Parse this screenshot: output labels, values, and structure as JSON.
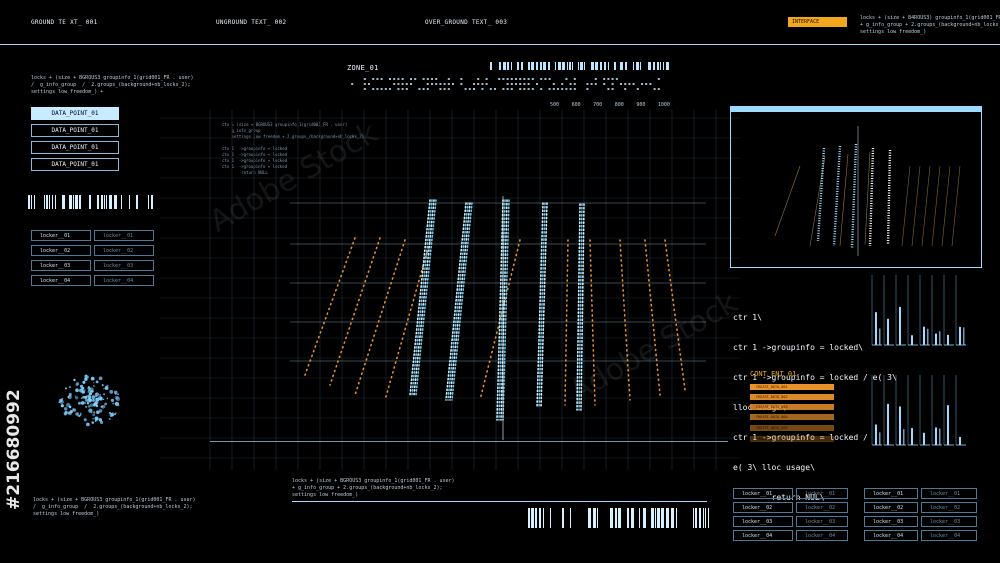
{
  "top_labels": [
    "GROUND TE    XT_ 001",
    "UNGROUND TEXT_ 002",
    "OVER_GROUND TEXT_ 003"
  ],
  "interface_badge": "INTERFACE",
  "top_right_code": "locks + (size + B4ROUS3) groupinfo_1(grid001_FR . user)\n+ g_info_group + 2.groups_(background+nb_locks_2)\nsettings low freedom_)",
  "left_code": "locks + (size + BGROUS3 groupinfo_1(grid001_FR . user)\n/  g_info_group  /  2.groups_(background+nb_locks_2);\nsettings low freedom_) +",
  "data_buttons": [
    "DATA_POINT_01",
    "DATA_POINT_01",
    "DATA_POINT_01",
    "DATA_POINT_01"
  ],
  "left_lockers": [
    [
      "locker__01",
      "locker__01"
    ],
    [
      "locker__02",
      "locker__02"
    ],
    [
      "locker__03",
      "locker__03"
    ],
    [
      "locker__04",
      "locker__04"
    ]
  ],
  "zone_label": "ZONE_01",
  "scale_ticks": [
    "500",
    "600",
    "700",
    "800",
    "900",
    "1000"
  ],
  "center_code": "ctx = (size + BGROUS3 groupinfo_1(grid001_FR . user)\n    g_info_group\n    settings low freedom + 2.groups_(background+nb_locks_2)\n\nctx 1  ->groupinfo + locked\nctx 1  ->groupinfo + locked\nctx 1  ->groupinfo + locked\nctx 1  ->groupinfo + locked\n        return NULL",
  "terminal_lines": [
    "ctr 1\\",
    "ctr 1 ->groupinfo = locked\\",
    "ctr 1 ->groupinfo = locked / e( 3\\",
    "lloc usage\\",
    "ctr 1 ->groupinfo = locked /",
    "e( 3\\ lloc usage\\",
    "        return NUL\\"
  ],
  "content_title": "CONT ENT_01",
  "content_bars": [
    "CREATE_DATA_001",
    "CREATE_DATA_002",
    "CREATE_DATA_003",
    "CREATE_DATA_004",
    "CREATE_DATA_005",
    "CREATE_DATA_006"
  ],
  "bottom_code": "locks + (size + BGROUS3 groupinfo_1(grid001_FR . user)\n+ g_info_group + 2.groups_(background+nb_locks_2);\nsettings low freedom_)",
  "bottom_left_code": "locks + (size + BGROUS3 groupinfo_1(grid001_FR . user)\n/  g_info_group  /  2.groups_(background+nb_locks_2);\nsettings low freedom_)",
  "bottom_lockers_left": [
    [
      "locker__01",
      "locker__01"
    ],
    [
      "locker__02",
      "locker__02"
    ],
    [
      "locker__03",
      "locker__03"
    ],
    [
      "locker__04",
      "locker__04"
    ]
  ],
  "bottom_lockers_right": [
    [
      "locker__01",
      "locker__01"
    ],
    [
      "locker__02",
      "locker__02"
    ],
    [
      "locker__03",
      "locker__03"
    ],
    [
      "locker__04",
      "locker__04"
    ]
  ],
  "watermark": "Adobe Stock",
  "stock_id": "#216680992",
  "colors": {
    "accent": "#9ed9ff",
    "orange": "#e8922c",
    "dots": "#cfefff"
  }
}
